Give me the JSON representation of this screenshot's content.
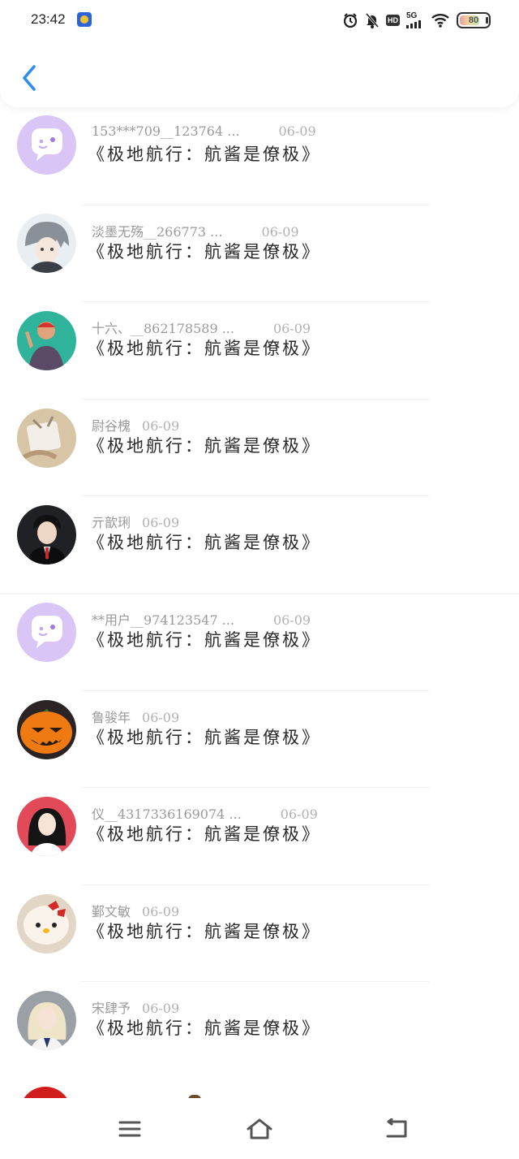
{
  "status_bar": {
    "time": "23:42",
    "network": "5G",
    "hd": "HD",
    "battery": "80"
  },
  "header": {
    "back_icon": "chevron-left-icon",
    "accent_color": "#2d8cf0"
  },
  "comments": [
    {
      "name": "153***709__123764 ...",
      "date": "06-09",
      "title": "《极地航行：航酱是僚极》",
      "avatar": "chat-placeholder"
    },
    {
      "name": "淡墨无殇__266773 ...",
      "date": "06-09",
      "title": "《极地航行：航酱是僚极》",
      "avatar": "anime-boy"
    },
    {
      "name": "十六、__862178589 ...",
      "date": "06-09",
      "title": "《极地航行：航酱是僚极》",
      "avatar": "basketball-player"
    },
    {
      "name": "尉谷槐",
      "date": "06-09",
      "title": "《极地航行：航酱是僚极》",
      "avatar": "hands-bag"
    },
    {
      "name": "亓歆琍",
      "date": "06-09",
      "title": "《极地航行：航酱是僚极》",
      "avatar": "suit-boy"
    },
    {
      "name": "**用户__974123547 ...",
      "date": "06-09",
      "title": "《极地航行：航酱是僚极》",
      "avatar": "chat-placeholder"
    },
    {
      "name": "鲁骏年",
      "date": "06-09",
      "title": "《极地航行：航酱是僚极》",
      "avatar": "pumpkin"
    },
    {
      "name": "仪__4317336169074 ...",
      "date": "06-09",
      "title": "《极地航行：航酱是僚极》",
      "avatar": "dark-hair-girl"
    },
    {
      "name": "鄞文敏",
      "date": "06-09",
      "title": "《极地航行：航酱是僚极》",
      "avatar": "hello-kitty"
    },
    {
      "name": "宋肆予",
      "date": "06-09",
      "title": "《极地航行：航酱是僚极》",
      "avatar": "blonde-girl"
    }
  ],
  "nav": {
    "menu_icon": "menu-icon",
    "home_icon": "home-icon",
    "back_icon": "back-icon"
  }
}
